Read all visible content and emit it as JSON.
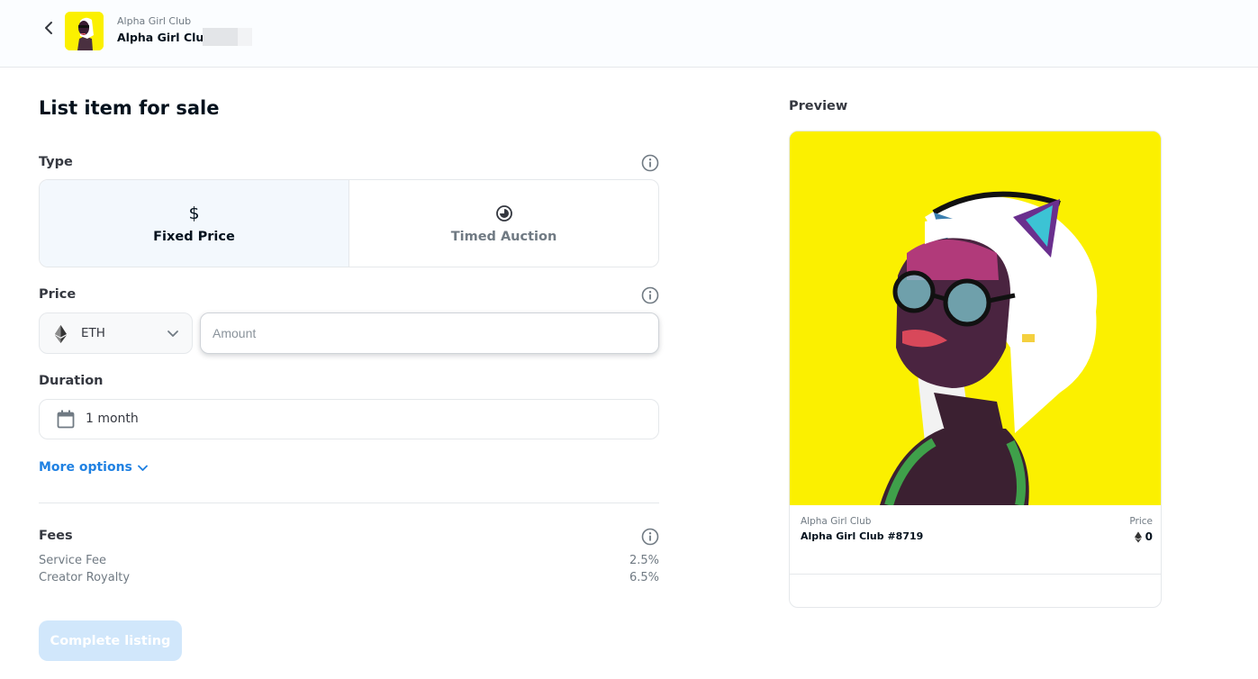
{
  "header": {
    "collection_small": "Alpha Girl Club",
    "collection_name": "Alpha Girl Club"
  },
  "form": {
    "title": "List item for sale",
    "type_label": "Type",
    "type_options": [
      {
        "label": "Fixed Price",
        "glyph": "$",
        "selected": true
      },
      {
        "label": "Timed Auction",
        "glyph": "◔",
        "selected": false
      }
    ],
    "price_label": "Price",
    "currency": "ETH",
    "amount_placeholder": "Amount",
    "duration_label": "Duration",
    "duration_value": "1 month",
    "more_options": "More options",
    "fees_label": "Fees",
    "fees": [
      {
        "name": "Service Fee",
        "value": "2.5%"
      },
      {
        "name": "Creator Royalty",
        "value": "6.5%"
      }
    ],
    "complete_button": "Complete listing"
  },
  "preview": {
    "title": "Preview",
    "collection": "Alpha Girl Club",
    "item_name": "Alpha Girl Club #8719",
    "price_label": "Price",
    "price_value": "0"
  },
  "colors": {
    "accent": "#2081e2",
    "nft_background": "#fbf000",
    "button_disabled": "#d1e7fb"
  }
}
